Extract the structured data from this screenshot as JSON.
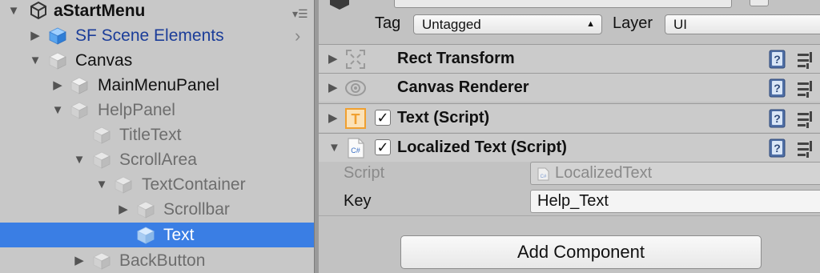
{
  "hierarchy": {
    "scene_name": "aStartMenu",
    "items": [
      {
        "label": "SF Scene Elements"
      },
      {
        "label": "Canvas"
      },
      {
        "label": "MainMenuPanel"
      },
      {
        "label": "HelpPanel"
      },
      {
        "label": "TitleText"
      },
      {
        "label": "ScrollArea"
      },
      {
        "label": "TextContainer"
      },
      {
        "label": "Scrollbar"
      },
      {
        "label": "Text"
      },
      {
        "label": "BackButton"
      }
    ]
  },
  "inspector": {
    "tag_label": "Tag",
    "tag_value": "Untagged",
    "layer_label": "Layer",
    "layer_value": "UI",
    "components": [
      {
        "title": "Rect Transform",
        "icon": "rect-transform-icon"
      },
      {
        "title": "Canvas Renderer",
        "icon": "canvas-renderer-icon"
      },
      {
        "title": "Text (Script)",
        "icon": "text-component-icon",
        "enabled": true
      },
      {
        "title": "Localized Text (Script)",
        "icon": "csharp-script-icon",
        "enabled": true
      }
    ],
    "fields": {
      "script_label": "Script",
      "script_value": "LocalizedText",
      "key_label": "Key",
      "key_value": "Help_Text"
    },
    "add_component_label": "Add Component"
  },
  "colors": {
    "selection": "#3a7ee4",
    "prefab_text": "#1b3d99",
    "inactive_text": "#6d6d6d",
    "text_icon_orange": "#f0a030"
  }
}
